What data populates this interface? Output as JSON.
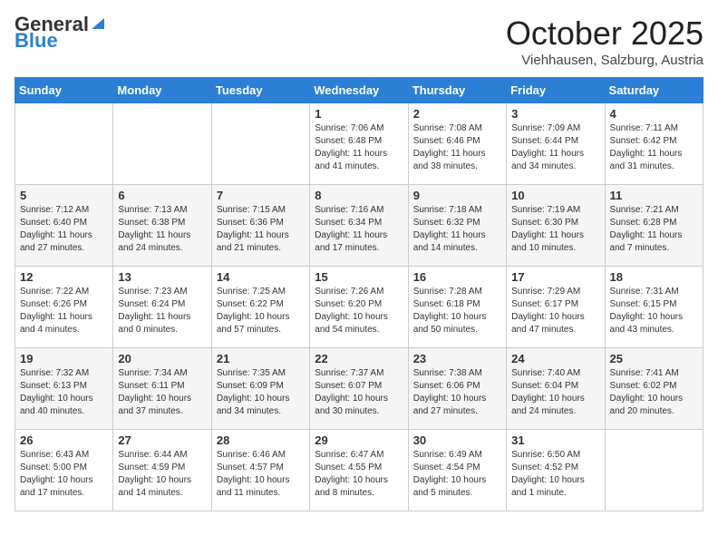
{
  "logo": {
    "general": "General",
    "blue": "Blue"
  },
  "header": {
    "month": "October 2025",
    "location": "Viehhausen, Salzburg, Austria"
  },
  "weekdays": [
    "Sunday",
    "Monday",
    "Tuesday",
    "Wednesday",
    "Thursday",
    "Friday",
    "Saturday"
  ],
  "weeks": [
    [
      {
        "day": "",
        "info": ""
      },
      {
        "day": "",
        "info": ""
      },
      {
        "day": "",
        "info": ""
      },
      {
        "day": "1",
        "info": "Sunrise: 7:06 AM\nSunset: 6:48 PM\nDaylight: 11 hours\nand 41 minutes."
      },
      {
        "day": "2",
        "info": "Sunrise: 7:08 AM\nSunset: 6:46 PM\nDaylight: 11 hours\nand 38 minutes."
      },
      {
        "day": "3",
        "info": "Sunrise: 7:09 AM\nSunset: 6:44 PM\nDaylight: 11 hours\nand 34 minutes."
      },
      {
        "day": "4",
        "info": "Sunrise: 7:11 AM\nSunset: 6:42 PM\nDaylight: 11 hours\nand 31 minutes."
      }
    ],
    [
      {
        "day": "5",
        "info": "Sunrise: 7:12 AM\nSunset: 6:40 PM\nDaylight: 11 hours\nand 27 minutes."
      },
      {
        "day": "6",
        "info": "Sunrise: 7:13 AM\nSunset: 6:38 PM\nDaylight: 11 hours\nand 24 minutes."
      },
      {
        "day": "7",
        "info": "Sunrise: 7:15 AM\nSunset: 6:36 PM\nDaylight: 11 hours\nand 21 minutes."
      },
      {
        "day": "8",
        "info": "Sunrise: 7:16 AM\nSunset: 6:34 PM\nDaylight: 11 hours\nand 17 minutes."
      },
      {
        "day": "9",
        "info": "Sunrise: 7:18 AM\nSunset: 6:32 PM\nDaylight: 11 hours\nand 14 minutes."
      },
      {
        "day": "10",
        "info": "Sunrise: 7:19 AM\nSunset: 6:30 PM\nDaylight: 11 hours\nand 10 minutes."
      },
      {
        "day": "11",
        "info": "Sunrise: 7:21 AM\nSunset: 6:28 PM\nDaylight: 11 hours\nand 7 minutes."
      }
    ],
    [
      {
        "day": "12",
        "info": "Sunrise: 7:22 AM\nSunset: 6:26 PM\nDaylight: 11 hours\nand 4 minutes."
      },
      {
        "day": "13",
        "info": "Sunrise: 7:23 AM\nSunset: 6:24 PM\nDaylight: 11 hours\nand 0 minutes."
      },
      {
        "day": "14",
        "info": "Sunrise: 7:25 AM\nSunset: 6:22 PM\nDaylight: 10 hours\nand 57 minutes."
      },
      {
        "day": "15",
        "info": "Sunrise: 7:26 AM\nSunset: 6:20 PM\nDaylight: 10 hours\nand 54 minutes."
      },
      {
        "day": "16",
        "info": "Sunrise: 7:28 AM\nSunset: 6:18 PM\nDaylight: 10 hours\nand 50 minutes."
      },
      {
        "day": "17",
        "info": "Sunrise: 7:29 AM\nSunset: 6:17 PM\nDaylight: 10 hours\nand 47 minutes."
      },
      {
        "day": "18",
        "info": "Sunrise: 7:31 AM\nSunset: 6:15 PM\nDaylight: 10 hours\nand 43 minutes."
      }
    ],
    [
      {
        "day": "19",
        "info": "Sunrise: 7:32 AM\nSunset: 6:13 PM\nDaylight: 10 hours\nand 40 minutes."
      },
      {
        "day": "20",
        "info": "Sunrise: 7:34 AM\nSunset: 6:11 PM\nDaylight: 10 hours\nand 37 minutes."
      },
      {
        "day": "21",
        "info": "Sunrise: 7:35 AM\nSunset: 6:09 PM\nDaylight: 10 hours\nand 34 minutes."
      },
      {
        "day": "22",
        "info": "Sunrise: 7:37 AM\nSunset: 6:07 PM\nDaylight: 10 hours\nand 30 minutes."
      },
      {
        "day": "23",
        "info": "Sunrise: 7:38 AM\nSunset: 6:06 PM\nDaylight: 10 hours\nand 27 minutes."
      },
      {
        "day": "24",
        "info": "Sunrise: 7:40 AM\nSunset: 6:04 PM\nDaylight: 10 hours\nand 24 minutes."
      },
      {
        "day": "25",
        "info": "Sunrise: 7:41 AM\nSunset: 6:02 PM\nDaylight: 10 hours\nand 20 minutes."
      }
    ],
    [
      {
        "day": "26",
        "info": "Sunrise: 6:43 AM\nSunset: 5:00 PM\nDaylight: 10 hours\nand 17 minutes."
      },
      {
        "day": "27",
        "info": "Sunrise: 6:44 AM\nSunset: 4:59 PM\nDaylight: 10 hours\nand 14 minutes."
      },
      {
        "day": "28",
        "info": "Sunrise: 6:46 AM\nSunset: 4:57 PM\nDaylight: 10 hours\nand 11 minutes."
      },
      {
        "day": "29",
        "info": "Sunrise: 6:47 AM\nSunset: 4:55 PM\nDaylight: 10 hours\nand 8 minutes."
      },
      {
        "day": "30",
        "info": "Sunrise: 6:49 AM\nSunset: 4:54 PM\nDaylight: 10 hours\nand 5 minutes."
      },
      {
        "day": "31",
        "info": "Sunrise: 6:50 AM\nSunset: 4:52 PM\nDaylight: 10 hours\nand 1 minute."
      },
      {
        "day": "",
        "info": ""
      }
    ]
  ]
}
